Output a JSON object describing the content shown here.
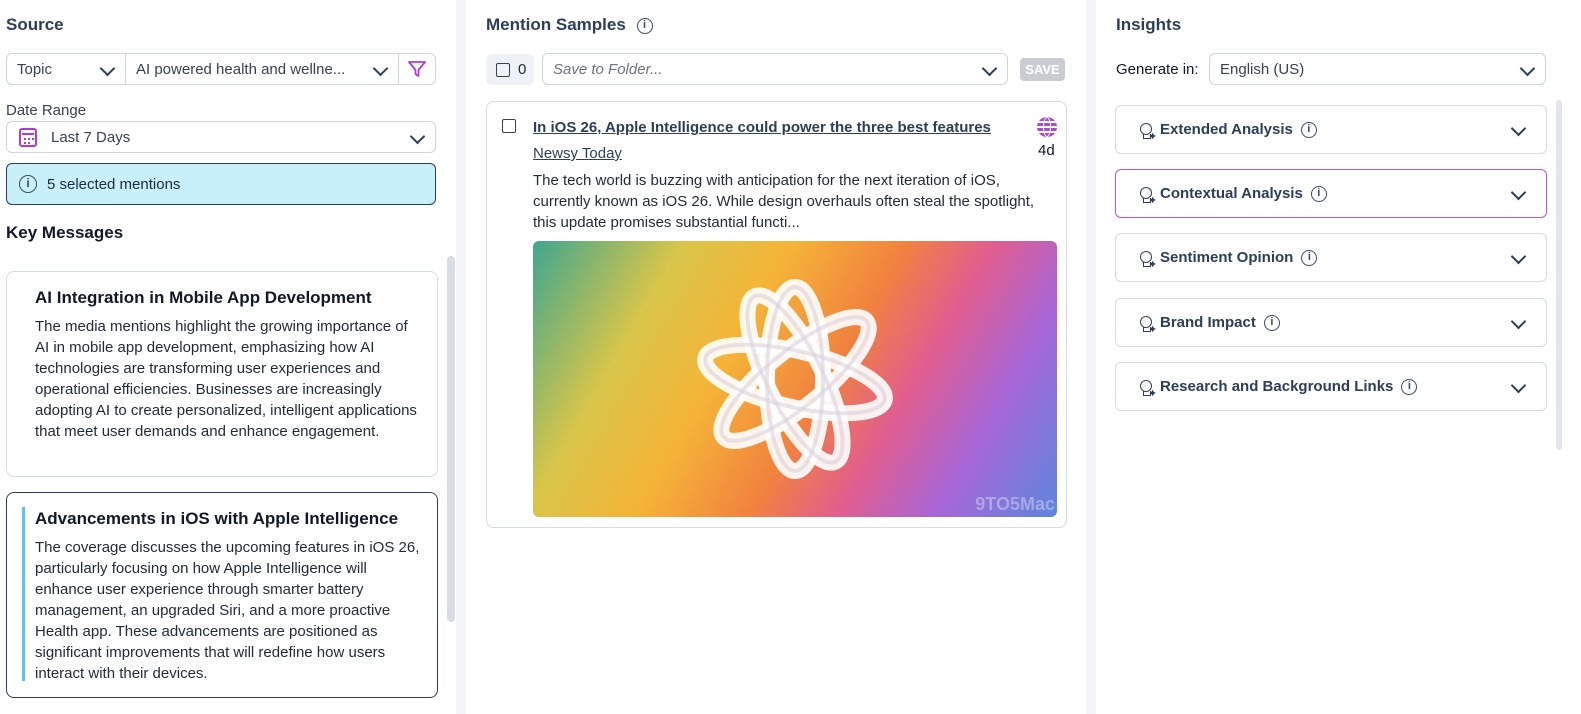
{
  "source": {
    "title": "Source",
    "topic_label": "Topic",
    "subject_value": "AI powered health and wellne...",
    "date_range_label": "Date Range",
    "date_range_value": "Last 7 Days",
    "selected_mentions": "5 selected mentions"
  },
  "key_messages": {
    "title": "Key Messages",
    "items": [
      {
        "title": "AI Integration in Mobile App Development",
        "body": "The media mentions highlight the growing importance of AI in mobile app development, emphasizing how AI technologies are transforming user experiences and operational efficiencies. Businesses are increasingly adopting AI to create personalized, intelligent applications that meet user demands and enhance engagement."
      },
      {
        "title": "Advancements in iOS with Apple Intelligence",
        "body": "The coverage discusses the upcoming features in iOS 26, particularly focusing on how Apple Intelligence will enhance user experience through smarter battery management, an upgraded Siri, and a more proactive Health app. These advancements are positioned as significant improvements that will redefine how users interact with their devices."
      }
    ]
  },
  "mention_samples": {
    "title": "Mention Samples",
    "selected_count": "0",
    "folder_placeholder": "Save to Folder...",
    "save_label": "SAVE",
    "mention": {
      "title": "In iOS 26, Apple Intelligence could power the three best features",
      "source": "Newsy Today",
      "age": "4d",
      "snippet": "The tech world is buzzing with anticipation for the next iteration of iOS, currently known as iOS 26. While design overhauls often steal the spotlight, this update promises substantial functi...",
      "image_watermark": "9TO5Mac"
    }
  },
  "insights": {
    "title": "Insights",
    "generate_label": "Generate in:",
    "language": "English (US)",
    "items": [
      {
        "label": "Extended Analysis"
      },
      {
        "label": "Contextual Analysis"
      },
      {
        "label": "Sentiment Opinion"
      },
      {
        "label": "Brand Impact"
      },
      {
        "label": "Research and Background Links"
      }
    ]
  },
  "colors": {
    "accent": "#2c3e58",
    "highlight": "#c24fd8",
    "banner": "#c8f0fb",
    "key_message_bar": "#5ec3e6"
  }
}
